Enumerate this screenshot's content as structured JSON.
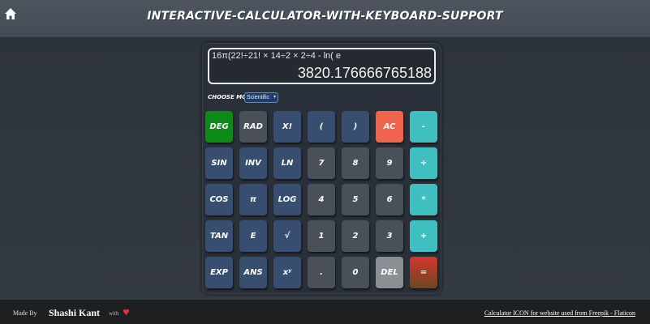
{
  "header": {
    "title": "Interactive-Calculator-with-Keyboard-Support"
  },
  "display": {
    "expression": "16π(22!÷21! × 14÷2 × 2÷4 - ln( e",
    "result": "3820.176666765188"
  },
  "mode": {
    "label": "Choose Mode :",
    "selected": "Scientific"
  },
  "buttons": {
    "deg": "DEG",
    "rad": "RAD",
    "fact": "X!",
    "lparen": "(",
    "rparen": ")",
    "ac": "AC",
    "minus": "-",
    "sin": "SIN",
    "inv": "INV",
    "ln": "LN",
    "n7": "7",
    "n8": "8",
    "n9": "9",
    "div": "÷",
    "cos": "COS",
    "pi": "π",
    "log": "LOG",
    "n4": "4",
    "n5": "5",
    "n6": "6",
    "mul": "*",
    "tan": "TAN",
    "e": "E",
    "sqrt": "√",
    "n1": "1",
    "n2": "2",
    "n3": "3",
    "plus": "+",
    "exp": "EXP",
    "ans": "ANS",
    "pow": "xʸ",
    "dot": ".",
    "n0": "0",
    "del": "DEL",
    "eq": "="
  },
  "footer": {
    "made_by": "Made By",
    "author": "Shashi Kant",
    "with": "with",
    "credit": "Calculator ICON for website used from Freepik - Flaticon"
  }
}
